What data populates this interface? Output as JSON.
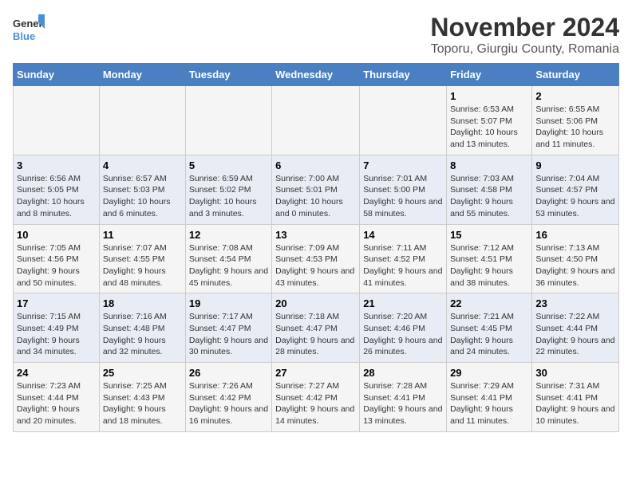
{
  "logo": {
    "line1": "General",
    "line2": "Blue"
  },
  "title": "November 2024",
  "location": "Toporu, Giurgiu County, Romania",
  "days_of_week": [
    "Sunday",
    "Monday",
    "Tuesday",
    "Wednesday",
    "Thursday",
    "Friday",
    "Saturday"
  ],
  "weeks": [
    [
      {
        "day": "",
        "info": ""
      },
      {
        "day": "",
        "info": ""
      },
      {
        "day": "",
        "info": ""
      },
      {
        "day": "",
        "info": ""
      },
      {
        "day": "",
        "info": ""
      },
      {
        "day": "1",
        "info": "Sunrise: 6:53 AM\nSunset: 5:07 PM\nDaylight: 10 hours and 13 minutes."
      },
      {
        "day": "2",
        "info": "Sunrise: 6:55 AM\nSunset: 5:06 PM\nDaylight: 10 hours and 11 minutes."
      }
    ],
    [
      {
        "day": "3",
        "info": "Sunrise: 6:56 AM\nSunset: 5:05 PM\nDaylight: 10 hours and 8 minutes."
      },
      {
        "day": "4",
        "info": "Sunrise: 6:57 AM\nSunset: 5:03 PM\nDaylight: 10 hours and 6 minutes."
      },
      {
        "day": "5",
        "info": "Sunrise: 6:59 AM\nSunset: 5:02 PM\nDaylight: 10 hours and 3 minutes."
      },
      {
        "day": "6",
        "info": "Sunrise: 7:00 AM\nSunset: 5:01 PM\nDaylight: 10 hours and 0 minutes."
      },
      {
        "day": "7",
        "info": "Sunrise: 7:01 AM\nSunset: 5:00 PM\nDaylight: 9 hours and 58 minutes."
      },
      {
        "day": "8",
        "info": "Sunrise: 7:03 AM\nSunset: 4:58 PM\nDaylight: 9 hours and 55 minutes."
      },
      {
        "day": "9",
        "info": "Sunrise: 7:04 AM\nSunset: 4:57 PM\nDaylight: 9 hours and 53 minutes."
      }
    ],
    [
      {
        "day": "10",
        "info": "Sunrise: 7:05 AM\nSunset: 4:56 PM\nDaylight: 9 hours and 50 minutes."
      },
      {
        "day": "11",
        "info": "Sunrise: 7:07 AM\nSunset: 4:55 PM\nDaylight: 9 hours and 48 minutes."
      },
      {
        "day": "12",
        "info": "Sunrise: 7:08 AM\nSunset: 4:54 PM\nDaylight: 9 hours and 45 minutes."
      },
      {
        "day": "13",
        "info": "Sunrise: 7:09 AM\nSunset: 4:53 PM\nDaylight: 9 hours and 43 minutes."
      },
      {
        "day": "14",
        "info": "Sunrise: 7:11 AM\nSunset: 4:52 PM\nDaylight: 9 hours and 41 minutes."
      },
      {
        "day": "15",
        "info": "Sunrise: 7:12 AM\nSunset: 4:51 PM\nDaylight: 9 hours and 38 minutes."
      },
      {
        "day": "16",
        "info": "Sunrise: 7:13 AM\nSunset: 4:50 PM\nDaylight: 9 hours and 36 minutes."
      }
    ],
    [
      {
        "day": "17",
        "info": "Sunrise: 7:15 AM\nSunset: 4:49 PM\nDaylight: 9 hours and 34 minutes."
      },
      {
        "day": "18",
        "info": "Sunrise: 7:16 AM\nSunset: 4:48 PM\nDaylight: 9 hours and 32 minutes."
      },
      {
        "day": "19",
        "info": "Sunrise: 7:17 AM\nSunset: 4:47 PM\nDaylight: 9 hours and 30 minutes."
      },
      {
        "day": "20",
        "info": "Sunrise: 7:18 AM\nSunset: 4:47 PM\nDaylight: 9 hours and 28 minutes."
      },
      {
        "day": "21",
        "info": "Sunrise: 7:20 AM\nSunset: 4:46 PM\nDaylight: 9 hours and 26 minutes."
      },
      {
        "day": "22",
        "info": "Sunrise: 7:21 AM\nSunset: 4:45 PM\nDaylight: 9 hours and 24 minutes."
      },
      {
        "day": "23",
        "info": "Sunrise: 7:22 AM\nSunset: 4:44 PM\nDaylight: 9 hours and 22 minutes."
      }
    ],
    [
      {
        "day": "24",
        "info": "Sunrise: 7:23 AM\nSunset: 4:44 PM\nDaylight: 9 hours and 20 minutes."
      },
      {
        "day": "25",
        "info": "Sunrise: 7:25 AM\nSunset: 4:43 PM\nDaylight: 9 hours and 18 minutes."
      },
      {
        "day": "26",
        "info": "Sunrise: 7:26 AM\nSunset: 4:42 PM\nDaylight: 9 hours and 16 minutes."
      },
      {
        "day": "27",
        "info": "Sunrise: 7:27 AM\nSunset: 4:42 PM\nDaylight: 9 hours and 14 minutes."
      },
      {
        "day": "28",
        "info": "Sunrise: 7:28 AM\nSunset: 4:41 PM\nDaylight: 9 hours and 13 minutes."
      },
      {
        "day": "29",
        "info": "Sunrise: 7:29 AM\nSunset: 4:41 PM\nDaylight: 9 hours and 11 minutes."
      },
      {
        "day": "30",
        "info": "Sunrise: 7:31 AM\nSunset: 4:41 PM\nDaylight: 9 hours and 10 minutes."
      }
    ]
  ]
}
